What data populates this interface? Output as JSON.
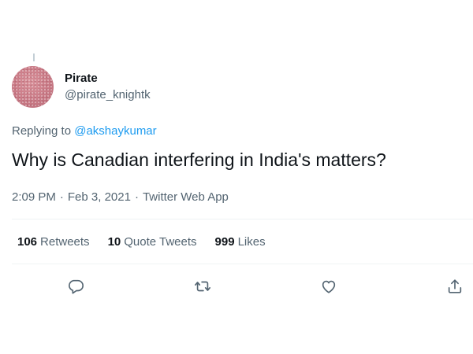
{
  "tweet": {
    "author": {
      "display_name": "Pirate",
      "handle": "@pirate_knightk"
    },
    "replying_to": {
      "prefix": "Replying to",
      "mention": "@akshaykumar"
    },
    "text": "Why is Canadian interfering in India's matters?",
    "time": "2:09 PM",
    "date": "Feb 3, 2021",
    "source": "Twitter Web App",
    "separator": "·",
    "stats": {
      "retweets_count": "106",
      "retweets_label": "Retweets",
      "quote_tweets_count": "10",
      "quote_tweets_label": "Quote Tweets",
      "likes_count": "999",
      "likes_label": "Likes"
    }
  },
  "icons": {
    "reply": "reply-icon",
    "retweet": "retweet-icon",
    "like": "heart-icon",
    "share": "share-icon"
  },
  "colors": {
    "link": "#1d9bf0",
    "secondary_text": "#536471",
    "primary_text": "#0f1419",
    "divider": "#eff3f4"
  }
}
